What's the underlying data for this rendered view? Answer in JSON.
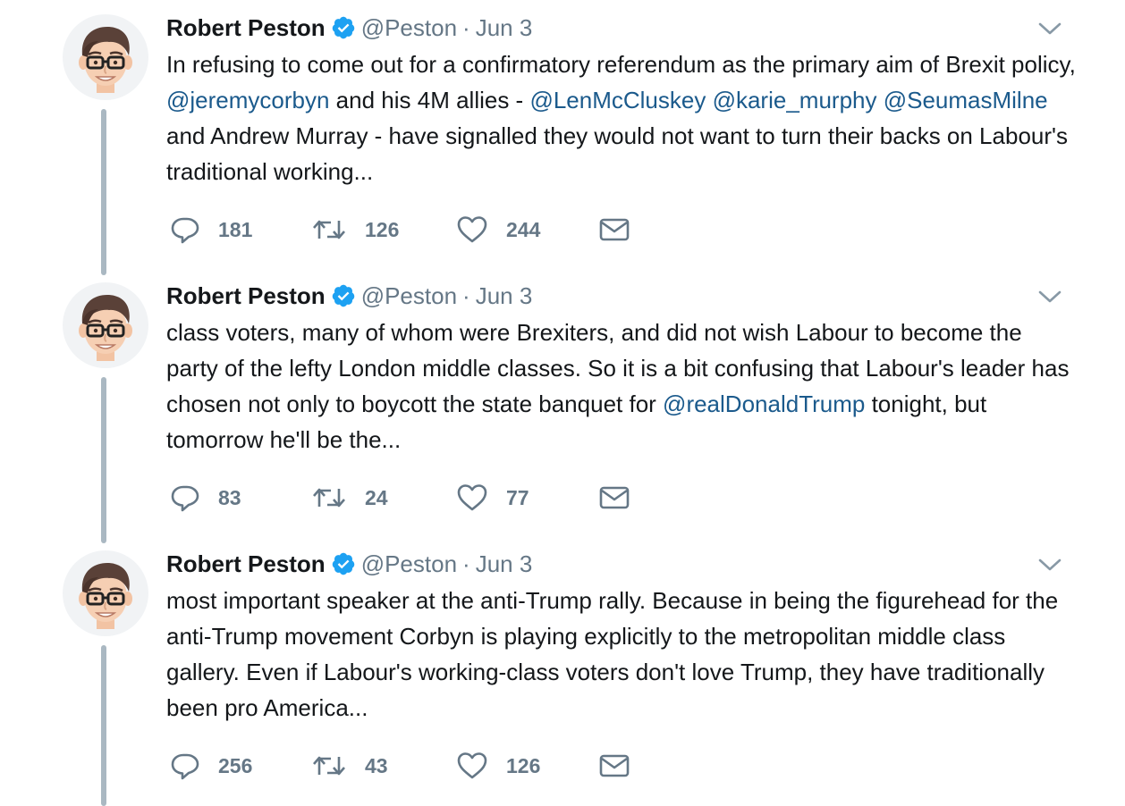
{
  "tweets": [
    {
      "author": "Robert Peston",
      "handle": "@Peston",
      "separator": "·",
      "date": "Jun 3",
      "text_parts": [
        {
          "t": "In refusing to come out for a confirmatory referendum as the primary aim of Brexit policy, ",
          "mention": false
        },
        {
          "t": "@jeremycorbyn",
          "mention": true
        },
        {
          "t": " and his 4M allies - ",
          "mention": false
        },
        {
          "t": "@LenMcCluskey",
          "mention": true
        },
        {
          "t": " ",
          "mention": false
        },
        {
          "t": "@karie_murphy",
          "mention": true
        },
        {
          "t": " ",
          "mention": false
        },
        {
          "t": "@SeumasMilne",
          "mention": true
        },
        {
          "t": " and Andrew Murray - have signalled they would not want to turn their backs on Labour's traditional working...",
          "mention": false
        }
      ],
      "replies": "181",
      "retweets": "126",
      "likes": "244"
    },
    {
      "author": "Robert Peston",
      "handle": "@Peston",
      "separator": "·",
      "date": "Jun 3",
      "text_parts": [
        {
          "t": "class voters, many of whom were Brexiters, and did not wish Labour to become the party of the lefty London middle classes. So it is a bit confusing that Labour's leader has chosen not only to boycott the state banquet for ",
          "mention": false
        },
        {
          "t": "@realDonaldTrump",
          "mention": true
        },
        {
          "t": " tonight, but tomorrow he'll be the...",
          "mention": false
        }
      ],
      "replies": "83",
      "retweets": "24",
      "likes": "77"
    },
    {
      "author": "Robert Peston",
      "handle": "@Peston",
      "separator": "·",
      "date": "Jun 3",
      "text_parts": [
        {
          "t": "most important speaker at the anti-Trump rally. Because in being the figurehead for the anti-Trump movement Corbyn is playing explicitly to the metropolitan middle class gallery. Even if Labour's working-class voters don't love Trump, they have traditionally been pro America...",
          "mention": false
        }
      ],
      "replies": "256",
      "retweets": "43",
      "likes": "126"
    }
  ],
  "colors": {
    "mention": "#1b5a8c",
    "muted": "#657786",
    "verified": "#1da1f2",
    "thread_line": "#aab8c2"
  },
  "icons": {
    "reply": "reply-icon",
    "retweet": "retweet-icon",
    "like": "heart-icon",
    "dm": "envelope-icon",
    "more": "chevron-down-icon",
    "verified": "verified-badge-icon"
  }
}
